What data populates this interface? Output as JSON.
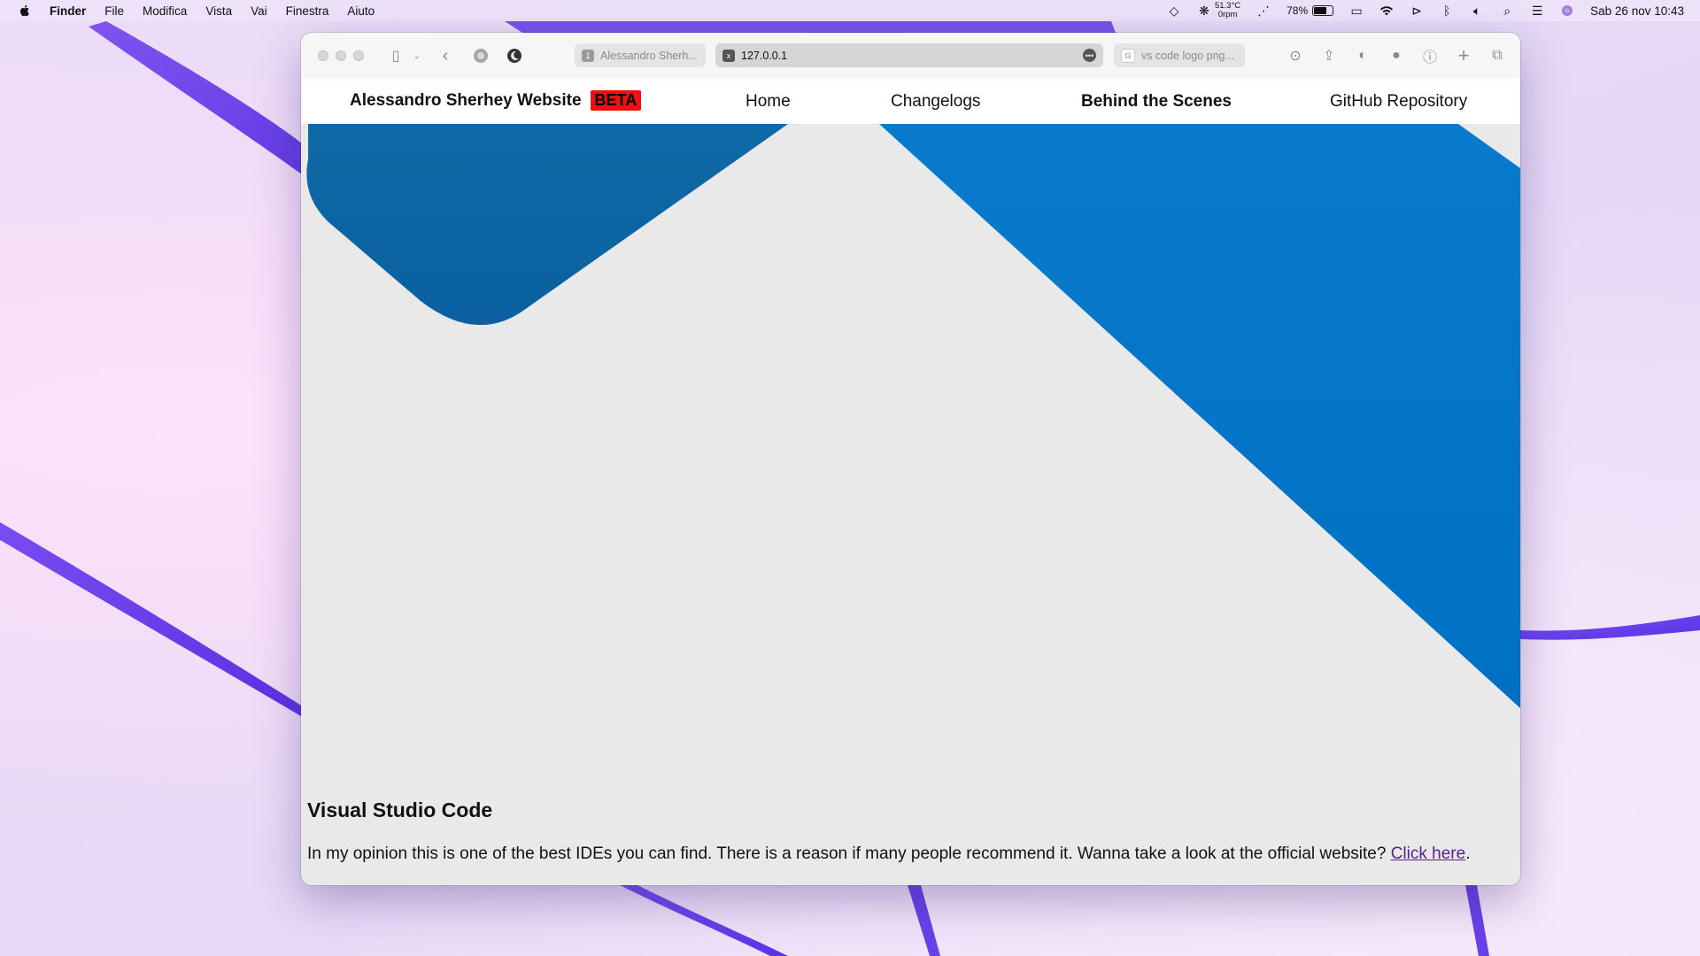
{
  "menubar": {
    "app_name": "Finder",
    "menus": [
      "File",
      "Modifica",
      "Vista",
      "Vai",
      "Finestra",
      "Aiuto"
    ],
    "temperature": "51.3°C",
    "fan": "0rpm",
    "battery_percent": "78%",
    "battery_level": 0.78,
    "clock": "Sab 26 nov  10:43"
  },
  "browser": {
    "tabs": [
      {
        "label": "Alessandro Sherh...",
        "favicon": "1"
      },
      {
        "label": "127.0.0.1",
        "favicon": "x"
      },
      {
        "label": "vs code logo png...",
        "favicon": "G"
      }
    ]
  },
  "site": {
    "brand": "Alessandro Sherhey Website",
    "badge": "BETA",
    "nav": [
      "Home",
      "Changelogs",
      "Behind the Scenes",
      "GitHub Repository"
    ],
    "active_nav": "Behind the Scenes",
    "colors": {
      "accent_blue": "#0078d4",
      "dark_blue": "#0a65a8",
      "badge_red": "#ee1111"
    }
  },
  "article": {
    "title": "Visual Studio Code",
    "text": "In my opinion this is one of the best IDEs you can find. There is a reason if many people recommend it. Wanna take a look at the official website? ",
    "link_label": "Click here",
    "trailing": "."
  }
}
